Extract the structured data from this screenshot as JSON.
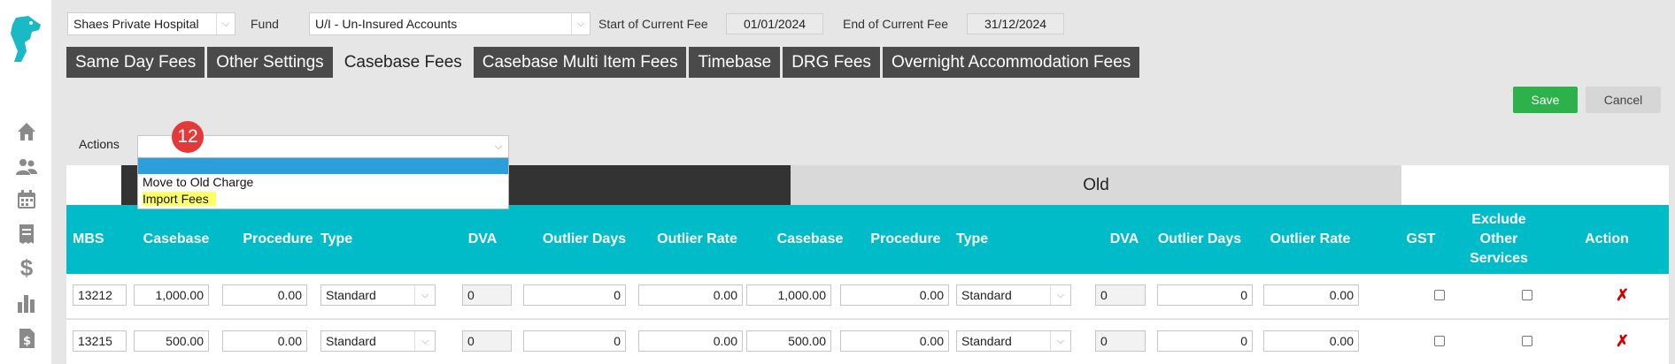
{
  "header": {
    "hospital": "Shaes Private Hospital",
    "fund_label": "Fund",
    "fund": "U/I - Un-Insured Accounts",
    "start_label": "Start of Current Fee",
    "start_date": "01/01/2024",
    "end_label": "End of Current Fee",
    "end_date": "31/12/2024"
  },
  "tabs": [
    {
      "label": "Same Day Fees"
    },
    {
      "label": "Other Settings"
    },
    {
      "label": "Casebase Fees"
    },
    {
      "label": "Casebase Multi Item Fees"
    },
    {
      "label": "Timebase"
    },
    {
      "label": "DRG Fees"
    },
    {
      "label": "Overnight Accommodation Fees"
    }
  ],
  "active_tab": "Casebase Fees",
  "buttons": {
    "save": "Save",
    "cancel": "Cancel"
  },
  "actions": {
    "label": "Actions",
    "selected": "",
    "options": [
      "",
      "Move to Old Charge",
      "Import Fees"
    ],
    "highlighted_option": "Import Fees"
  },
  "step_badge": "12",
  "groups": {
    "old": "Old"
  },
  "columns": [
    "MBS",
    "Casebase",
    "Procedure",
    "Type",
    "DVA",
    "Outlier Days",
    "Outlier Rate",
    "Casebase",
    "Procedure",
    "Type",
    "DVA",
    "Outlier Days",
    "Outlier Rate",
    "GST",
    "Exclude Other Services",
    "Action"
  ],
  "rows": [
    {
      "mbs": "13212",
      "casebase": "1,000.00",
      "procedure": "0.00",
      "type": "Standard",
      "dva": "0",
      "outlier_days": "0",
      "outlier_rate": "0.00",
      "old_casebase": "1,000.00",
      "old_procedure": "0.00",
      "old_type": "Standard",
      "old_dva": "0",
      "old_outlier_days": "0",
      "old_outlier_rate": "0.00",
      "gst": false,
      "exclude_other": false,
      "action": "✗"
    },
    {
      "mbs": "13215",
      "casebase": "500.00",
      "procedure": "0.00",
      "type": "Standard",
      "dva": "0",
      "outlier_days": "0",
      "outlier_rate": "0.00",
      "old_casebase": "500.00",
      "old_procedure": "0.00",
      "old_type": "Standard",
      "old_dva": "0",
      "old_outlier_days": "0",
      "old_outlier_rate": "0.00",
      "gst": false,
      "exclude_other": false,
      "action": "✗"
    }
  ],
  "colors": {
    "teal_header": "#00bcc8",
    "tab_dark": "#4a4a4a",
    "save_green": "#2db14b",
    "badge_red": "#e3393a",
    "delete_red": "#d20000",
    "highlight_yellow": "#ffff66",
    "dropdown_selected_blue": "#2b9fdb"
  },
  "icons": [
    "dog-logo-icon",
    "home-icon",
    "users-icon",
    "calendar-icon",
    "receipt-icon",
    "dollar-icon",
    "bar-chart-icon",
    "invoice-dollar-icon"
  ]
}
